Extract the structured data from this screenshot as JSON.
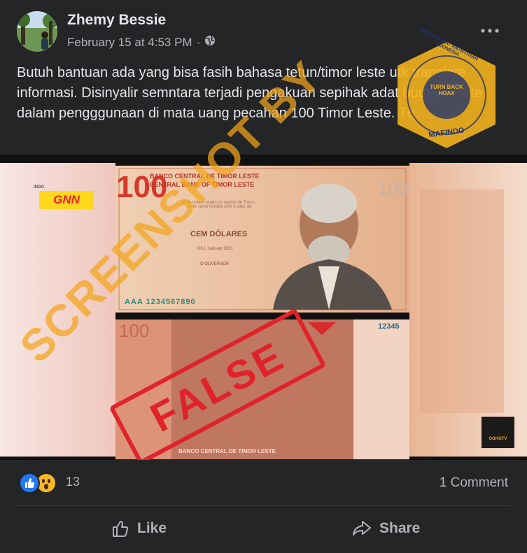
{
  "post": {
    "author": "Zhemy Bessie",
    "timestamp": "February 15 at 4:53 PM",
    "separator": "·",
    "privacy_icon": "globe-icon",
    "text": "Butuh bantuan ada yang bisa fasih bahasa tetun/timor leste utk translate informasi. Disinyalir semntara terjadi pengakuan sepihak adat budaya Rote dalam pengggunaan di mata uang pecahan 100 Timor Leste. Tq"
  },
  "media": {
    "banknote_title": "BANCO CENTRAL DE TIMOR LESTE",
    "banknote_subtitle": "CENTRAL BANK OF TIMOR LESTE",
    "denomination": "CEM DÓLARES",
    "number_top": "100",
    "number_bottom": "100",
    "small_text": "Este nota é usado no registo de Timor-Leste como fundisa com o valor de",
    "date_text": "DILI, January 2021",
    "governor_label": "O GOVERNOR",
    "serial": "AAA 1234567890",
    "serial_back": "12345",
    "back_bank": "BANCO CENTRAL DE TIMOR LESTE",
    "gnn_logo": "GNN",
    "gnn_small": "INDO",
    "stamp_false": "FALSE",
    "watermark": "SCREENSHOT BY",
    "mafindo_ring": "MASYARAKAT ANTIFITNAH INDONESIA",
    "mafindo_name": "MAFINDO",
    "mafindo_center": "TURN BACK HOAX",
    "corner_logo": "GOHOTV"
  },
  "stats": {
    "reaction_count": "13",
    "comment_count": "1 Comment"
  },
  "actions": {
    "like_label": "Like",
    "share_label": "Share"
  },
  "colors": {
    "background": "#242526",
    "text_primary": "#e4e6eb",
    "text_secondary": "#b0b3b8",
    "false_stamp": "#e0232a",
    "watermark": "#f3a51a",
    "like_blue": "#2078f4",
    "wow_yellow": "#f7b928"
  }
}
